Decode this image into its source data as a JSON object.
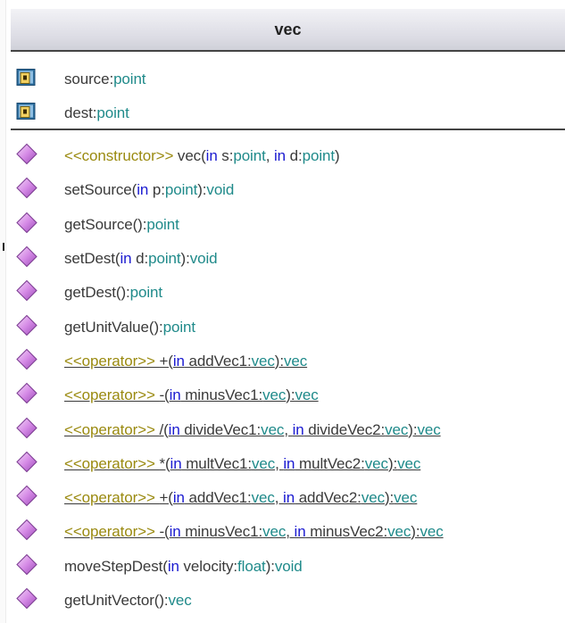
{
  "class_name": "vec",
  "attributes": [
    {
      "name": "source",
      "sep": ":",
      "type": "point"
    },
    {
      "name": "dest",
      "sep": ":",
      "type": "point"
    }
  ],
  "operations": [
    {
      "stereo": "<<constructor>> ",
      "name": "vec(",
      "kw1": "in",
      "p1": " s:",
      "t1": "point",
      "sep": ", ",
      "kw2": "in",
      "p2": " d:",
      "t2": "point",
      "close": ")",
      "ret": ""
    },
    {
      "stereo": "",
      "name": "setSource(",
      "kw1": "in",
      "p1": " p:",
      "t1": "point",
      "sep": "",
      "kw2": "",
      "p2": "",
      "t2": "",
      "close": "):",
      "ret": "void"
    },
    {
      "stereo": "",
      "name": "getSource():",
      "kw1": "",
      "p1": "",
      "t1": "",
      "sep": "",
      "kw2": "",
      "p2": "",
      "t2": "",
      "close": "",
      "ret": "point"
    },
    {
      "stereo": "",
      "name": "setDest(",
      "kw1": "in",
      "p1": " d:",
      "t1": "point",
      "sep": "",
      "kw2": "",
      "p2": "",
      "t2": "",
      "close": "):",
      "ret": "void"
    },
    {
      "stereo": "",
      "name": "getDest():",
      "kw1": "",
      "p1": "",
      "t1": "",
      "sep": "",
      "kw2": "",
      "p2": "",
      "t2": "",
      "close": "",
      "ret": "point"
    },
    {
      "stereo": "",
      "name": "getUnitValue():",
      "kw1": "",
      "p1": "",
      "t1": "",
      "sep": "",
      "kw2": "",
      "p2": "",
      "t2": "",
      "close": "",
      "ret": "point"
    },
    {
      "stereo": "<<operator>> ",
      "name": "+(",
      "kw1": "in",
      "p1": " addVec1:",
      "t1": "vec",
      "sep": "",
      "kw2": "",
      "p2": "",
      "t2": "",
      "close": "):",
      "ret": "vec"
    },
    {
      "stereo": "<<operator>> ",
      "name": "-(",
      "kw1": "in",
      "p1": " minusVec1:",
      "t1": "vec",
      "sep": "",
      "kw2": "",
      "p2": "",
      "t2": "",
      "close": "):",
      "ret": "vec"
    },
    {
      "stereo": "<<operator>> ",
      "name": "/(",
      "kw1": "in",
      "p1": " divideVec1:",
      "t1": "vec",
      "sep": ", ",
      "kw2": "in",
      "p2": " divideVec2:",
      "t2": "vec",
      "close": "):",
      "ret": "vec"
    },
    {
      "stereo": "<<operator>> ",
      "name": "*(",
      "kw1": "in",
      "p1": " multVec1:",
      "t1": "vec",
      "sep": ", ",
      "kw2": "in",
      "p2": " multVec2:",
      "t2": "vec",
      "close": "):",
      "ret": "vec"
    },
    {
      "stereo": "<<operator>> ",
      "name": "+(",
      "kw1": "in",
      "p1": " addVec1:",
      "t1": "vec",
      "sep": ", ",
      "kw2": "in",
      "p2": " addVec2:",
      "t2": "vec",
      "close": "):",
      "ret": "vec"
    },
    {
      "stereo": "<<operator>> ",
      "name": "-(",
      "kw1": "in",
      "p1": " minusVec1:",
      "t1": "vec",
      "sep": ", ",
      "kw2": "in",
      "p2": " minusVec2:",
      "t2": "vec",
      "close": "):",
      "ret": "vec"
    },
    {
      "stereo": "",
      "name": "moveStepDest(",
      "kw1": "in",
      "p1": " velocity:",
      "t1": "float",
      "sep": "",
      "kw2": "",
      "p2": "",
      "t2": "",
      "close": "):",
      "ret": "void"
    },
    {
      "stereo": "",
      "name": "getUnitVector():",
      "kw1": "",
      "p1": "",
      "t1": "",
      "sep": "",
      "kw2": "",
      "p2": "",
      "t2": "",
      "close": "",
      "ret": "vec"
    }
  ]
}
